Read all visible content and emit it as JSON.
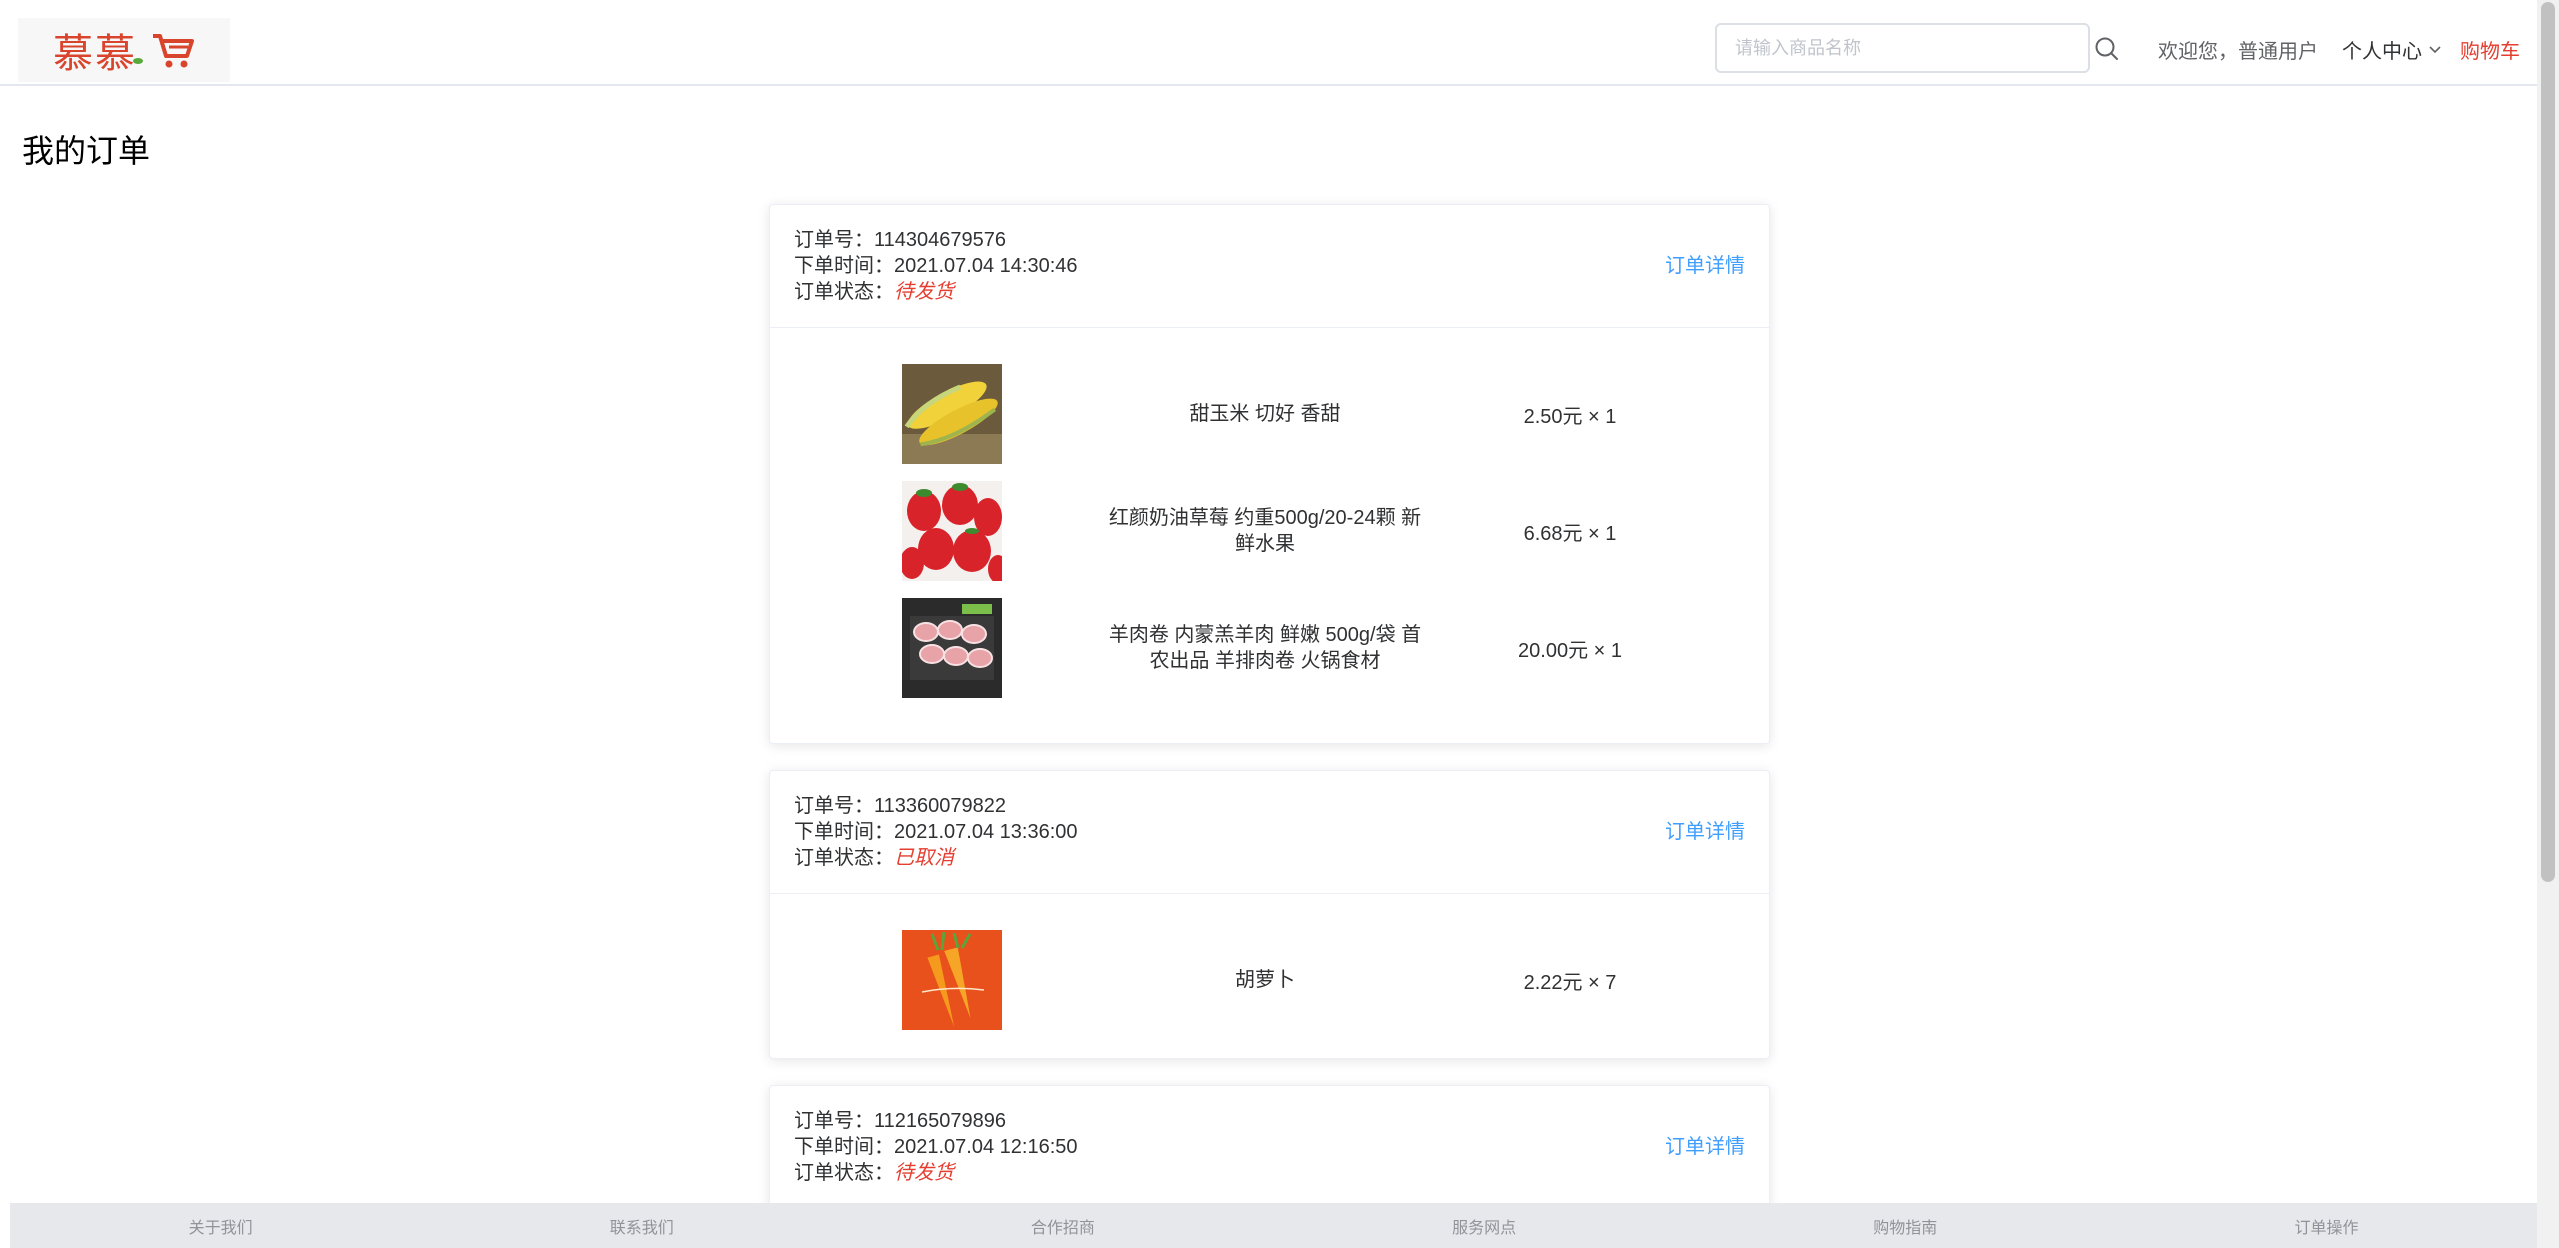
{
  "header": {
    "logo_text": "慕慕",
    "search_placeholder": "请输入商品名称",
    "welcome": "欢迎您，普通用户",
    "center_label": "个人中心",
    "cart_label": "购物车"
  },
  "page_title": "我的订单",
  "labels": {
    "order_no": "订单号：",
    "order_time": "下单时间：",
    "order_status": "订单状态：",
    "detail": "订单详情"
  },
  "orders": [
    {
      "number": "114304679576",
      "time": "2021.07.04 14:30:46",
      "status": "待发货",
      "items": [
        {
          "name": "甜玉米 切好 香甜",
          "price": "2.50元 × 1",
          "image": "corn-image"
        },
        {
          "name": "红颜奶油草莓 约重500g/20-24颗 新鲜水果",
          "price": "6.68元 × 1",
          "image": "strawberry-image"
        },
        {
          "name": "羊肉卷 内蒙羔羊肉 鲜嫩 500g/袋 首农出品 羊排肉卷 火锅食材",
          "price": "20.00元 × 1",
          "image": "lamb-roll-image"
        }
      ]
    },
    {
      "number": "113360079822",
      "time": "2021.07.04 13:36:00",
      "status": "已取消",
      "items": [
        {
          "name": "胡萝卜",
          "price": "2.22元 × 7",
          "image": "carrot-image"
        }
      ]
    },
    {
      "number": "112165079896",
      "time": "2021.07.04 12:16:50",
      "status": "待发货",
      "items": []
    }
  ],
  "footer": [
    "关于我们",
    "联系我们",
    "合作招商",
    "服务网点",
    "购物指南",
    "订单操作"
  ],
  "colors": {
    "accent_red": "#e53e30",
    "link_blue": "#409eff",
    "footer_bg": "#e6e8eb"
  }
}
